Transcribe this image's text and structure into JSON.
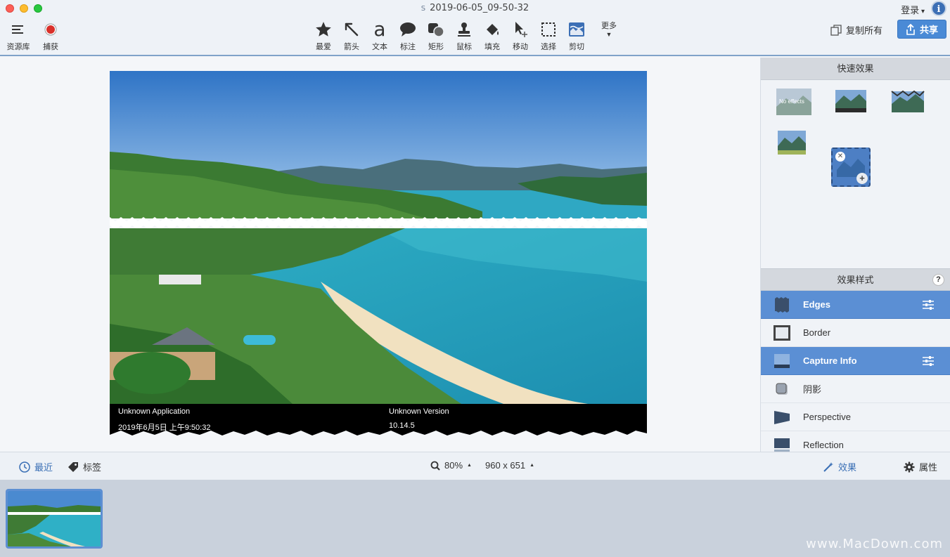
{
  "window": {
    "title": "2019-06-05_09-50-32",
    "login_label": "登录",
    "info_label": "i"
  },
  "toolbar_left": [
    {
      "label": "资源库",
      "icon": "library-icon"
    },
    {
      "label": "捕获",
      "icon": "capture-icon"
    }
  ],
  "toolbar_tools": [
    {
      "label": "最爱",
      "icon": "star-icon"
    },
    {
      "label": "箭头",
      "icon": "arrow-icon"
    },
    {
      "label": "文本",
      "icon": "text-icon"
    },
    {
      "label": "标注",
      "icon": "callout-icon"
    },
    {
      "label": "矩形",
      "icon": "shape-icon"
    },
    {
      "label": "鼠标",
      "icon": "stamp-icon"
    },
    {
      "label": "填充",
      "icon": "fill-icon"
    },
    {
      "label": "移动",
      "icon": "move-icon"
    },
    {
      "label": "选择",
      "icon": "select-icon"
    },
    {
      "label": "剪切",
      "icon": "crop-icon"
    }
  ],
  "toolbar_more": "更多",
  "copy_all_label": "复制所有",
  "share_label": "共享",
  "capture_info": {
    "app": "Unknown Application",
    "date": "2019年6月5日 上午9:50:32",
    "version_label": "Unknown Version",
    "version": "10.14.5"
  },
  "quick_effects": {
    "title": "快速效果",
    "no_effects_label": "No effects"
  },
  "effect_styles": {
    "title": "效果样式",
    "help_label": "?",
    "items": [
      {
        "label": "Edges",
        "active": true
      },
      {
        "label": "Border",
        "active": false
      },
      {
        "label": "Capture Info",
        "active": true
      },
      {
        "label": "阴影",
        "active": false
      },
      {
        "label": "Perspective",
        "active": false
      },
      {
        "label": "Reflection",
        "active": false
      }
    ]
  },
  "statusbar": {
    "recent_label": "最近",
    "tags_label": "标签",
    "zoom": "80%",
    "dimensions": "960 x 651",
    "effects_label": "效果",
    "properties_label": "属性"
  },
  "watermark": "www.MacDown.com",
  "colors": {
    "accent": "#4a8ad6",
    "active_row": "#5b8fd4",
    "capture_bar": "#000000"
  }
}
